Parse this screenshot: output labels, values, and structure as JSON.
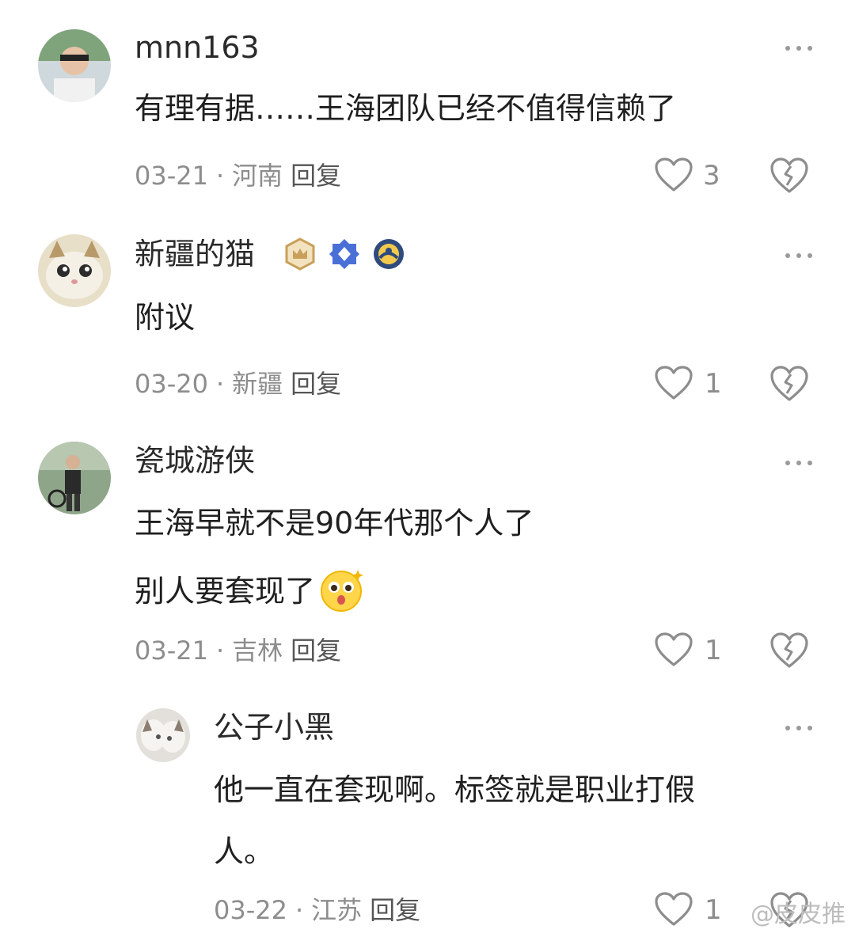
{
  "comments": [
    {
      "username": "mnn163",
      "lines": [
        "有理有据……王海团队已经不值得信赖了"
      ],
      "date": "03-21",
      "location": "河南",
      "reply_label": "回复",
      "likes": "3"
    },
    {
      "username": "新疆的猫",
      "lines": [
        "附议"
      ],
      "date": "03-20",
      "location": "新疆",
      "reply_label": "回复",
      "likes": "1"
    },
    {
      "username": "瓷城游侠",
      "lines": [
        "王海早就不是90年代那个人了",
        "别人要套现了"
      ],
      "date": "03-21",
      "location": "吉林",
      "reply_label": "回复",
      "likes": "1"
    },
    {
      "username": "公子小黑",
      "lines": [
        "他一直在套现啊。标签就是职业打假",
        "人。"
      ],
      "date": "03-22",
      "location": "江苏",
      "reply_label": "回复",
      "likes": "1"
    }
  ],
  "icons": {
    "more": "more-dots-icon",
    "like": "heart-outline-icon",
    "dislike": "broken-heart-icon",
    "badges": [
      "crown-badge-icon",
      "diamond-badge-icon",
      "round-badge-icon"
    ],
    "emoji": "surprised-face-emoji"
  },
  "watermark": "@皮皮推",
  "colors": {
    "text": "#1f1f1f",
    "meta": "#8d8d8d",
    "icon": "#8d8d8d"
  }
}
